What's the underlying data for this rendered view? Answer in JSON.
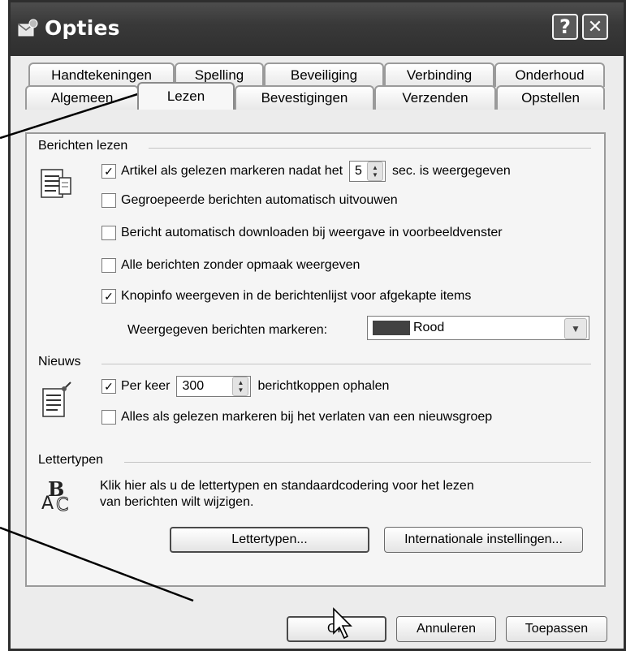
{
  "window": {
    "title": "Opties",
    "help_button": "?",
    "close_button": "✕"
  },
  "tabs": {
    "row1": [
      "Handtekeningen",
      "Spelling",
      "Beveiliging",
      "Verbinding",
      "Onderhoud"
    ],
    "row2": [
      "Algemeen",
      "Lezen",
      "Bevestigingen",
      "Verzenden",
      "Opstellen"
    ],
    "active": "Lezen"
  },
  "berichten": {
    "label": "Berichten lezen",
    "mark_read_prefix": "Artikel als gelezen markeren nadat het",
    "mark_read_seconds": "5",
    "mark_read_suffix": "sec. is weergegeven",
    "mark_read_checked": true,
    "expand_groups": "Gegroepeerde berichten automatisch uitvouwen",
    "expand_groups_checked": false,
    "auto_download": "Bericht automatisch downloaden bij weergave in voorbeeldvenster",
    "auto_download_checked": false,
    "plain_text": "Alle berichten zonder opmaak weergeven",
    "plain_text_checked": false,
    "tooltips": "Knopinfo weergeven in de berichtenlijst voor afgekapte items",
    "tooltips_checked": true,
    "mark_label": "Weergegeven berichten markeren:",
    "mark_color_name": "Rood",
    "mark_color": "#424242"
  },
  "nieuws": {
    "label": "Nieuws",
    "per_keer": "Per keer",
    "per_keer_value": "300",
    "per_keer_suffix": "berichtkoppen ophalen",
    "per_keer_checked": true,
    "mark_all_read": "Alles als gelezen markeren bij het verlaten van een nieuwsgroep",
    "mark_all_read_checked": false
  },
  "lettertypen": {
    "label": "Lettertypen",
    "description_line1": "Klik hier als u de lettertypen en standaardcodering voor het lezen",
    "description_line2": "van berichten wilt wijzigen.",
    "fonts_button": "Lettertypen...",
    "intl_button": "Internationale instellingen..."
  },
  "footer": {
    "ok": "OK",
    "cancel": "Annuleren",
    "apply": "Toepassen"
  }
}
